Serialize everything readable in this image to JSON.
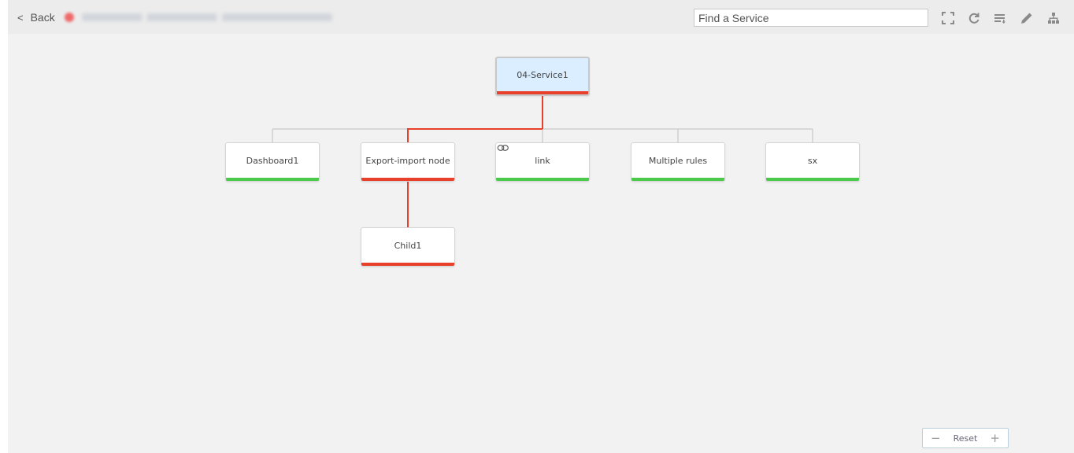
{
  "header": {
    "back_label": "Back",
    "back_chevron": "<",
    "title_blurred": true,
    "status_color": "#ef6a6a",
    "search_placeholder": "Find a Service",
    "search_value": "",
    "toolbar": [
      {
        "name": "fullscreen-icon",
        "title": "Fullscreen"
      },
      {
        "name": "refresh-icon",
        "title": "Refresh"
      },
      {
        "name": "sort-list-icon",
        "title": "Sort"
      },
      {
        "name": "edit-pencil-icon",
        "title": "Edit"
      },
      {
        "name": "hierarchy-icon",
        "title": "Hierarchy"
      }
    ]
  },
  "colors": {
    "critical": "#e8402a",
    "ok": "#4ac94a",
    "edge_default": "#d0d0d0",
    "edge_critical": "#e8402a",
    "root_fill": "#dbeeff"
  },
  "tree": {
    "root": {
      "id": "root",
      "label": "04-Service1",
      "status": "critical"
    },
    "children": [
      {
        "id": "dashboard1",
        "label": "Dashboard1",
        "status": "ok",
        "linked": false
      },
      {
        "id": "export-import",
        "label": "Export-import node",
        "status": "critical",
        "linked": false
      },
      {
        "id": "link",
        "label": "link",
        "status": "ok",
        "linked": true
      },
      {
        "id": "multiple-rules",
        "label": "Multiple rules",
        "status": "ok",
        "linked": false
      },
      {
        "id": "sx",
        "label": "sx",
        "status": "ok",
        "linked": false
      }
    ],
    "grandchildren": [
      {
        "id": "child1",
        "label": "Child1",
        "status": "critical",
        "parent": "export-import"
      }
    ]
  },
  "zoom_control": {
    "minus": "−",
    "reset": "Reset",
    "plus": "+"
  }
}
